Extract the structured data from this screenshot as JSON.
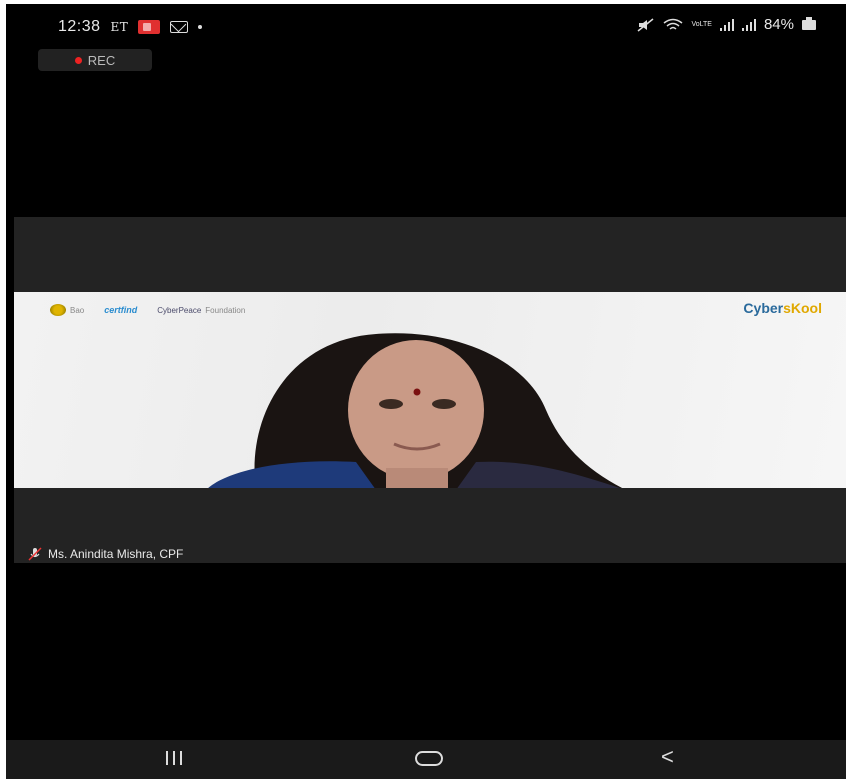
{
  "status_bar": {
    "time": "12:38",
    "carrier": "ET",
    "lte_label": "VoLTE",
    "battery_percent": "84%",
    "icons": [
      "mute-icon",
      "wifi-icon",
      "volte-icon",
      "signal-icon",
      "signal-icon",
      "battery-icon"
    ]
  },
  "meeting": {
    "rec_label": "REC",
    "participant_name": "Ms. Anindita Mishra, CPF"
  },
  "slide": {
    "sponsor_1": "Bao",
    "sponsor_2": "certfind",
    "sponsor_3": "CyberPeace",
    "sponsor_3_suffix": "Foundation",
    "brand_main": "Cyber",
    "brand_accent": "sKool"
  },
  "nav": {
    "recents_label": "Recent apps",
    "home_label": "Home",
    "back_label": "<"
  },
  "colors": {
    "rec": "#e22222",
    "background": "#000000",
    "tile": "#232323"
  }
}
